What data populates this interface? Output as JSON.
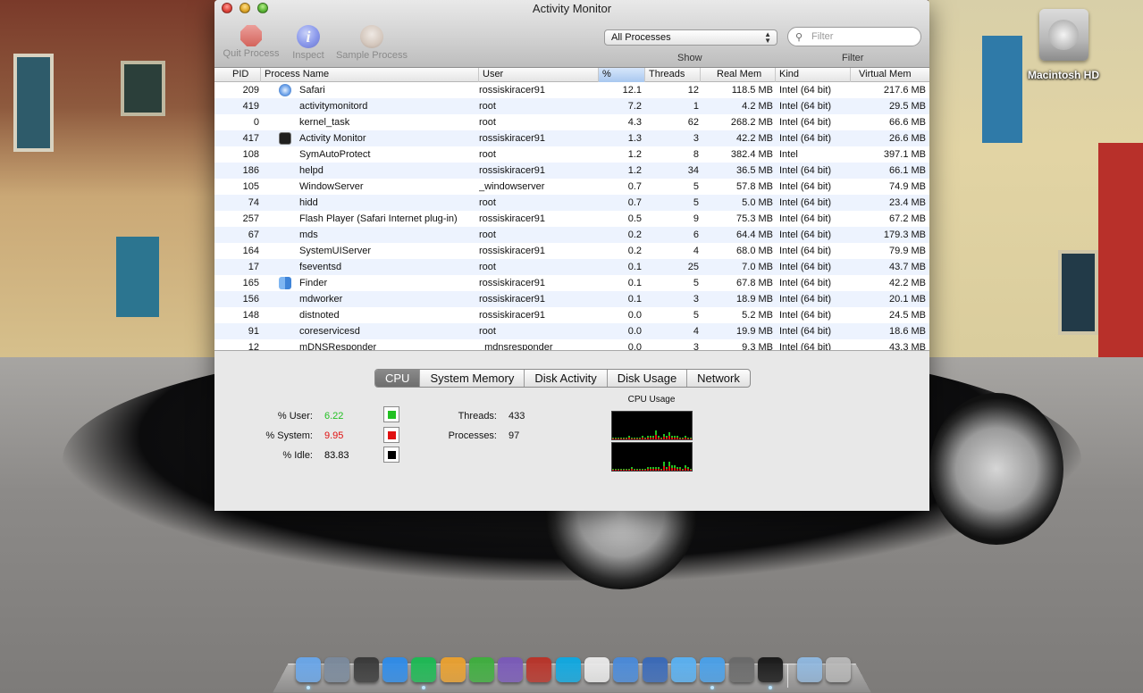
{
  "window": {
    "title": "Activity Monitor",
    "toolbar": {
      "quit_label": "Quit Process",
      "inspect_label": "Inspect",
      "sample_label": "Sample Process",
      "show_selected": "All Processes",
      "show_label": "Show",
      "filter_placeholder": "Filter",
      "filter_label": "Filter"
    },
    "columns": [
      "PID",
      "Process Name",
      "User",
      "% CPU",
      "Threads",
      "Real Mem",
      "Kind",
      "Virtual Mem"
    ],
    "sorted_column": "% CPU",
    "sort_arrow": "▼",
    "processes": [
      {
        "pid": "209",
        "icon": "safari-icon",
        "name": "Safari",
        "user": "rossiskiracer91",
        "cpu": "12.1",
        "threads": "12",
        "real_mem": "118.5 MB",
        "kind": "Intel (64 bit)",
        "virtual_mem": "217.6 MB"
      },
      {
        "pid": "419",
        "icon": "",
        "name": "activitymonitord",
        "user": "root",
        "cpu": "7.2",
        "threads": "1",
        "real_mem": "4.2 MB",
        "kind": "Intel (64 bit)",
        "virtual_mem": "29.5 MB"
      },
      {
        "pid": "0",
        "icon": "",
        "name": "kernel_task",
        "user": "root",
        "cpu": "4.3",
        "threads": "62",
        "real_mem": "268.2 MB",
        "kind": "Intel (64 bit)",
        "virtual_mem": "66.6 MB"
      },
      {
        "pid": "417",
        "icon": "activity-monitor-icon",
        "name": "Activity Monitor",
        "user": "rossiskiracer91",
        "cpu": "1.3",
        "threads": "3",
        "real_mem": "42.2 MB",
        "kind": "Intel (64 bit)",
        "virtual_mem": "26.6 MB"
      },
      {
        "pid": "108",
        "icon": "",
        "name": "SymAutoProtect",
        "user": "root",
        "cpu": "1.2",
        "threads": "8",
        "real_mem": "382.4 MB",
        "kind": "Intel",
        "virtual_mem": "397.1 MB"
      },
      {
        "pid": "186",
        "icon": "",
        "name": "helpd",
        "user": "rossiskiracer91",
        "cpu": "1.2",
        "threads": "34",
        "real_mem": "36.5 MB",
        "kind": "Intel (64 bit)",
        "virtual_mem": "66.1 MB"
      },
      {
        "pid": "105",
        "icon": "",
        "name": "WindowServer",
        "user": "_windowserver",
        "cpu": "0.7",
        "threads": "5",
        "real_mem": "57.8 MB",
        "kind": "Intel (64 bit)",
        "virtual_mem": "74.9 MB"
      },
      {
        "pid": "74",
        "icon": "",
        "name": "hidd",
        "user": "root",
        "cpu": "0.7",
        "threads": "5",
        "real_mem": "5.0 MB",
        "kind": "Intel (64 bit)",
        "virtual_mem": "23.4 MB"
      },
      {
        "pid": "257",
        "icon": "",
        "name": "Flash Player (Safari Internet plug-in)",
        "user": "rossiskiracer91",
        "cpu": "0.5",
        "threads": "9",
        "real_mem": "75.3 MB",
        "kind": "Intel (64 bit)",
        "virtual_mem": "67.2 MB"
      },
      {
        "pid": "67",
        "icon": "",
        "name": "mds",
        "user": "root",
        "cpu": "0.2",
        "threads": "6",
        "real_mem": "64.4 MB",
        "kind": "Intel (64 bit)",
        "virtual_mem": "179.3 MB"
      },
      {
        "pid": "164",
        "icon": "",
        "name": "SystemUIServer",
        "user": "rossiskiracer91",
        "cpu": "0.2",
        "threads": "4",
        "real_mem": "68.0 MB",
        "kind": "Intel (64 bit)",
        "virtual_mem": "79.9 MB"
      },
      {
        "pid": "17",
        "icon": "",
        "name": "fseventsd",
        "user": "root",
        "cpu": "0.1",
        "threads": "25",
        "real_mem": "7.0 MB",
        "kind": "Intel (64 bit)",
        "virtual_mem": "43.7 MB"
      },
      {
        "pid": "165",
        "icon": "finder-icon",
        "name": "Finder",
        "user": "rossiskiracer91",
        "cpu": "0.1",
        "threads": "5",
        "real_mem": "67.8 MB",
        "kind": "Intel (64 bit)",
        "virtual_mem": "42.2 MB"
      },
      {
        "pid": "156",
        "icon": "",
        "name": "mdworker",
        "user": "rossiskiracer91",
        "cpu": "0.1",
        "threads": "3",
        "real_mem": "18.9 MB",
        "kind": "Intel (64 bit)",
        "virtual_mem": "20.1 MB"
      },
      {
        "pid": "148",
        "icon": "",
        "name": "distnoted",
        "user": "rossiskiracer91",
        "cpu": "0.0",
        "threads": "5",
        "real_mem": "5.2 MB",
        "kind": "Intel (64 bit)",
        "virtual_mem": "24.5 MB"
      },
      {
        "pid": "91",
        "icon": "",
        "name": "coreservicesd",
        "user": "root",
        "cpu": "0.0",
        "threads": "4",
        "real_mem": "19.9 MB",
        "kind": "Intel (64 bit)",
        "virtual_mem": "18.6 MB"
      },
      {
        "pid": "12",
        "icon": "",
        "name": "mDNSResponder",
        "user": "_mdnsresponder",
        "cpu": "0.0",
        "threads": "3",
        "real_mem": "9.3 MB",
        "kind": "Intel (64 bit)",
        "virtual_mem": "43.3 MB"
      }
    ],
    "tabs": [
      "CPU",
      "System Memory",
      "Disk Activity",
      "Disk Usage",
      "Network"
    ],
    "active_tab": "CPU",
    "cpu": {
      "user_label": "% User:",
      "user_value": "6.22",
      "user_color": "#22c022",
      "system_label": "% System:",
      "system_value": "9.95",
      "system_color": "#e01010",
      "idle_label": "% Idle:",
      "idle_value": "83.83",
      "idle_color": "#000000",
      "threads_label": "Threads:",
      "threads_value": "433",
      "processes_label": "Processes:",
      "processes_value": "97",
      "usage_title": "CPU Usage"
    }
  },
  "desktop": {
    "drive_label": "Macintosh HD"
  },
  "dock": {
    "apps": [
      "finder-icon",
      "launchpad-icon",
      "dashboard-icon",
      "app-store-icon",
      "spotify-icon",
      "keynote-icon",
      "numbers-icon",
      "script-editor-icon",
      "dictionary-icon",
      "skype-icon",
      "ical-icon",
      "iphoto-icon",
      "xcode-icon",
      "itunes-icon",
      "safari-icon",
      "facetime-icon",
      "activity-monitor-icon"
    ],
    "other": [
      "applications-folder-icon",
      "trash-icon"
    ]
  }
}
